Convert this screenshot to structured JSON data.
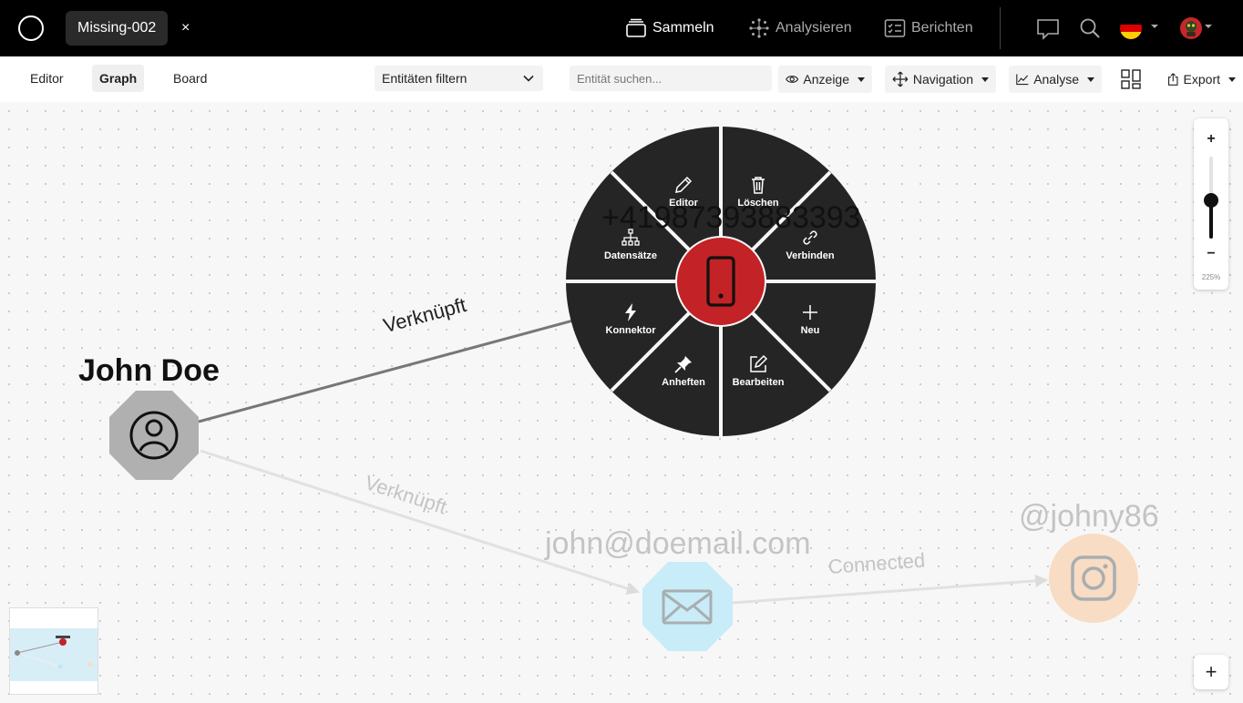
{
  "app": {
    "case_tab": "Missing-002",
    "close_glyph": "×"
  },
  "topnav": {
    "collect": "Sammeln",
    "analyze": "Analysieren",
    "reports": "Berichten"
  },
  "views": {
    "editor": "Editor",
    "graph": "Graph",
    "board": "Board",
    "active": "Graph"
  },
  "toolbar": {
    "filter_label": "Entitäten filtern",
    "search_placeholder": "Entität suchen...",
    "display": "Anzeige",
    "navigation": "Navigation",
    "analysis": "Analyse",
    "export": "Export"
  },
  "zoom": {
    "plus": "+",
    "minus": "−",
    "level": "225%",
    "slider_fraction": 0.45
  },
  "graph": {
    "nodes": {
      "person": {
        "label": "John Doe",
        "icon": "person-icon",
        "color": "#b0b0b0"
      },
      "phone": {
        "label": "+41987393883393",
        "icon": "phone-icon",
        "color": "#c32226"
      },
      "email": {
        "label": "john@doemail.com",
        "icon": "mail-icon",
        "color": "#c8ecf8"
      },
      "instagram": {
        "label": "@johny86",
        "icon": "instagram-icon",
        "color": "#f8dcc3"
      }
    },
    "edges": {
      "person_phone": "Verknüpft",
      "person_email": "Verknüpft",
      "email_instagram": "Connected"
    }
  },
  "radial_menu": {
    "editor": "Editor",
    "delete": "Löschen",
    "connect": "Verbinden",
    "new": "Neu",
    "edit": "Bearbeiten",
    "pin": "Anheften",
    "connector": "Konnektor",
    "records": "Datensätze"
  },
  "canvas": {
    "add_button": "+"
  },
  "colors": {
    "menu_bg": "#252525",
    "accent": "#c32226",
    "edge_dark": "#777777",
    "edge_faded": "#dedede"
  }
}
